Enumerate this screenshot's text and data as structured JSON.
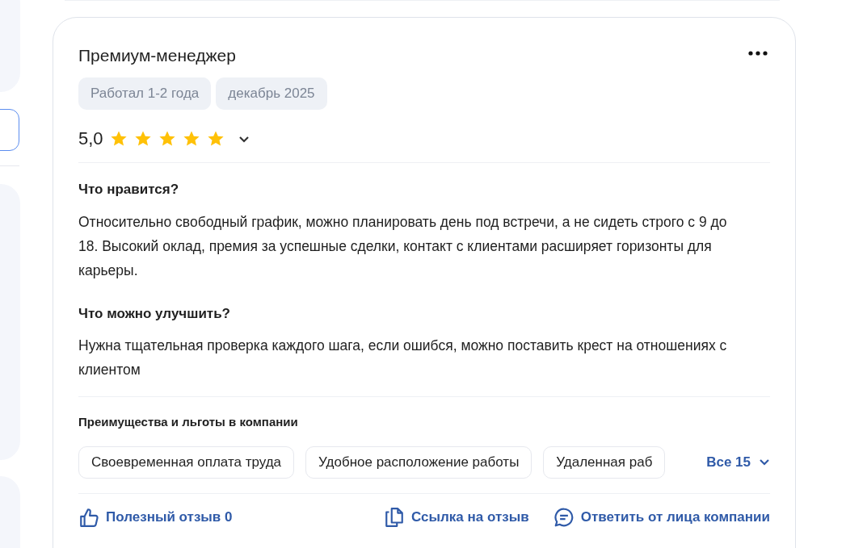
{
  "review": {
    "title": "Премиум-менеджер",
    "tags": [
      "Работал 1-2 года",
      "декабрь 2025"
    ],
    "rating": "5,0",
    "stars": 5,
    "sections": [
      {
        "heading": "Что нравится?",
        "text": "Относительно свободный график, можно планировать день под встречи, а не сидеть строго с 9 до 18. Высокий оклад, премия за успешные сделки, контакт с клиентами расширяет горизонты для карьеры."
      },
      {
        "heading": "Что можно улучшить?",
        "text": "Нужна тщательная проверка каждого шага, если ошибся, можно поставить крест на отношениях с клиентом"
      }
    ],
    "benefits_heading": "Преимущества и льготы в компании",
    "benefits": [
      "Своевременная оплата труда",
      "Удобное расположение работы",
      "Удаленная раб"
    ],
    "benefits_all": "Все 15",
    "actions": [
      {
        "kind": "like",
        "label": "Полезный отзыв 0"
      },
      {
        "kind": "link",
        "label": "Ссылка на отзыв"
      },
      {
        "kind": "reply",
        "label": "Ответить от лица компании"
      }
    ]
  }
}
